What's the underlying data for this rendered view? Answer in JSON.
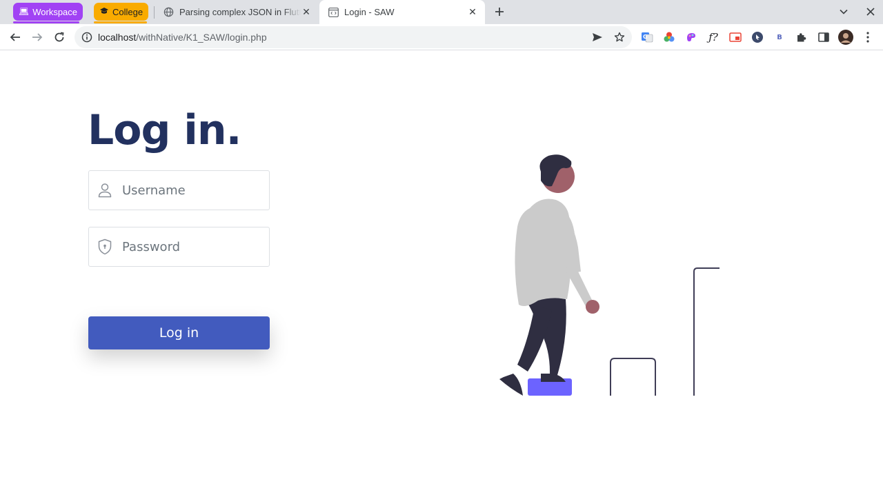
{
  "browser": {
    "tab_groups": [
      {
        "label": "Workspace",
        "color": "#a142f4",
        "icon": "laptop-icon"
      },
      {
        "label": "College",
        "color": "#f9ab00",
        "icon": "graduation-cap-icon"
      }
    ],
    "tabs": [
      {
        "title": "Parsing complex JSON in Flutter",
        "icon": "globe-icon",
        "active": false
      },
      {
        "title": "Login - SAW",
        "icon": "code-page-icon",
        "active": true
      }
    ],
    "url": {
      "host": "localhost",
      "path": "/withNative/K1_SAW/login.php"
    }
  },
  "page": {
    "title": "Log in.",
    "username": {
      "placeholder": "Username",
      "value": ""
    },
    "password": {
      "placeholder": "Password",
      "value": ""
    },
    "submit_label": "Log in"
  },
  "colors": {
    "title": "#22315f",
    "button": "#425bbe",
    "figure_shirt": "#cbcbcb",
    "figure_pants": "#2f2e41",
    "figure_skin": "#a0616a",
    "step_block": "#6c63ff"
  }
}
